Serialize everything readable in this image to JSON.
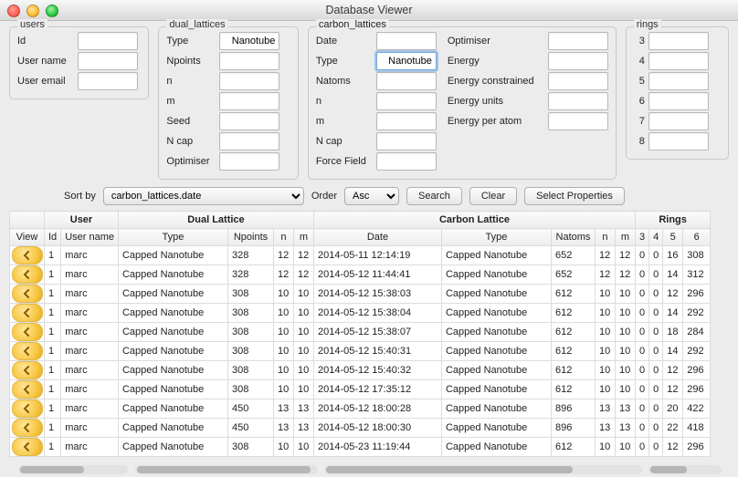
{
  "window": {
    "title": "Database Viewer"
  },
  "filters": {
    "users": {
      "legend": "users",
      "fields": [
        {
          "label": "Id",
          "value": ""
        },
        {
          "label": "User name",
          "value": ""
        },
        {
          "label": "User email",
          "value": ""
        }
      ]
    },
    "dual": {
      "legend": "dual_lattices",
      "fields": [
        {
          "label": "Type",
          "value": "Nanotube"
        },
        {
          "label": "Npoints",
          "value": ""
        },
        {
          "label": "n",
          "value": ""
        },
        {
          "label": "m",
          "value": ""
        },
        {
          "label": "Seed",
          "value": ""
        },
        {
          "label": "N cap",
          "value": ""
        },
        {
          "label": "Optimiser",
          "value": ""
        }
      ]
    },
    "carbon": {
      "legend": "carbon_lattices",
      "col1": [
        {
          "label": "Date",
          "value": ""
        },
        {
          "label": "Type",
          "value": "Nanotube",
          "focused": true
        },
        {
          "label": "Natoms",
          "value": ""
        },
        {
          "label": "n",
          "value": ""
        },
        {
          "label": "m",
          "value": ""
        },
        {
          "label": "N cap",
          "value": ""
        },
        {
          "label": "Force Field",
          "value": ""
        }
      ],
      "col2": [
        {
          "label": "Optimiser",
          "value": ""
        },
        {
          "label": "Energy",
          "value": ""
        },
        {
          "label": "Energy constrained",
          "value": ""
        },
        {
          "label": "Energy units",
          "value": ""
        },
        {
          "label": "Energy per atom",
          "value": ""
        }
      ]
    },
    "rings": {
      "legend": "rings",
      "fields": [
        {
          "label": "3",
          "value": ""
        },
        {
          "label": "4",
          "value": ""
        },
        {
          "label": "5",
          "value": ""
        },
        {
          "label": "6",
          "value": ""
        },
        {
          "label": "7",
          "value": ""
        },
        {
          "label": "8",
          "value": ""
        }
      ]
    }
  },
  "controls": {
    "sort_label": "Sort by",
    "sort_value": "carbon_lattices.date",
    "order_label": "Order",
    "order_value": "Asc",
    "search": "Search",
    "clear": "Clear",
    "select_props": "Select Properties"
  },
  "table": {
    "groups": [
      "",
      "User",
      "Dual Lattice",
      "Carbon Lattice",
      "Rings"
    ],
    "group_spans": [
      1,
      2,
      4,
      5,
      4
    ],
    "cols": [
      "View",
      "Id",
      "User name",
      "Type",
      "Npoints",
      "n",
      "m",
      "Date",
      "Type",
      "Natoms",
      "n",
      "m",
      "3",
      "4",
      "5",
      "6"
    ],
    "widths": [
      38,
      18,
      62,
      120,
      50,
      22,
      22,
      140,
      120,
      48,
      22,
      22,
      14,
      14,
      22,
      30
    ],
    "rows": [
      [
        1,
        "marc",
        "Capped Nanotube",
        328,
        12,
        12,
        "2014-05-11 12:14:19",
        "Capped Nanotube",
        652,
        12,
        12,
        0,
        0,
        16,
        308
      ],
      [
        1,
        "marc",
        "Capped Nanotube",
        328,
        12,
        12,
        "2014-05-12 11:44:41",
        "Capped Nanotube",
        652,
        12,
        12,
        0,
        0,
        14,
        312
      ],
      [
        1,
        "marc",
        "Capped Nanotube",
        308,
        10,
        10,
        "2014-05-12 15:38:03",
        "Capped Nanotube",
        612,
        10,
        10,
        0,
        0,
        12,
        296
      ],
      [
        1,
        "marc",
        "Capped Nanotube",
        308,
        10,
        10,
        "2014-05-12 15:38:04",
        "Capped Nanotube",
        612,
        10,
        10,
        0,
        0,
        14,
        292
      ],
      [
        1,
        "marc",
        "Capped Nanotube",
        308,
        10,
        10,
        "2014-05-12 15:38:07",
        "Capped Nanotube",
        612,
        10,
        10,
        0,
        0,
        18,
        284
      ],
      [
        1,
        "marc",
        "Capped Nanotube",
        308,
        10,
        10,
        "2014-05-12 15:40:31",
        "Capped Nanotube",
        612,
        10,
        10,
        0,
        0,
        14,
        292
      ],
      [
        1,
        "marc",
        "Capped Nanotube",
        308,
        10,
        10,
        "2014-05-12 15:40:32",
        "Capped Nanotube",
        612,
        10,
        10,
        0,
        0,
        12,
        296
      ],
      [
        1,
        "marc",
        "Capped Nanotube",
        308,
        10,
        10,
        "2014-05-12 17:35:12",
        "Capped Nanotube",
        612,
        10,
        10,
        0,
        0,
        12,
        296
      ],
      [
        1,
        "marc",
        "Capped Nanotube",
        450,
        13,
        13,
        "2014-05-12 18:00:28",
        "Capped Nanotube",
        896,
        13,
        13,
        0,
        0,
        20,
        422
      ],
      [
        1,
        "marc",
        "Capped Nanotube",
        450,
        13,
        13,
        "2014-05-12 18:00:30",
        "Capped Nanotube",
        896,
        13,
        13,
        0,
        0,
        22,
        418
      ],
      [
        1,
        "marc",
        "Capped Nanotube",
        308,
        10,
        10,
        "2014-05-23 11:19:44",
        "Capped Nanotube",
        612,
        10,
        10,
        0,
        0,
        12,
        296
      ]
    ]
  }
}
